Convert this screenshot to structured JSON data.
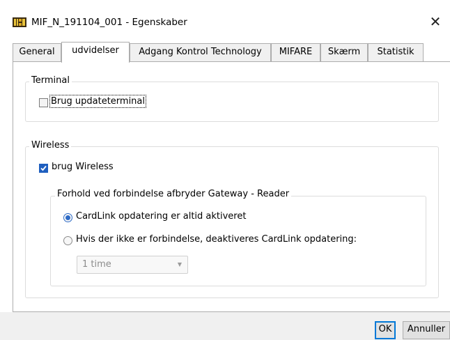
{
  "window": {
    "title": "MIF_N_191104_001 - Egenskaber"
  },
  "tabs": [
    {
      "label": "General"
    },
    {
      "label": "udvidelser"
    },
    {
      "label": "Adgang Kontrol Technology"
    },
    {
      "label": "MIFARE"
    },
    {
      "label": "Skærm"
    },
    {
      "label": "Statistik"
    }
  ],
  "terminal": {
    "legend": "Terminal",
    "checkbox_label": "Brug updateterminal",
    "checked": false
  },
  "wireless": {
    "legend": "Wireless",
    "checkbox_label": "brug Wireless",
    "checked": true,
    "subgroup": {
      "legend": "Forhold ved forbindelse afbryder Gateway - Reader",
      "radio1_label": "CardLink opdatering er altid aktiveret",
      "radio2_label": "Hvis der ikke er forbindelse, deaktiveres CardLink opdatering:",
      "selected": "radio1",
      "dropdown_value": "1 time"
    }
  },
  "buttons": {
    "ok": "OK",
    "cancel": "Annuller"
  },
  "colors": {
    "accent": "#0078d7",
    "check": "#1f5fbf"
  }
}
